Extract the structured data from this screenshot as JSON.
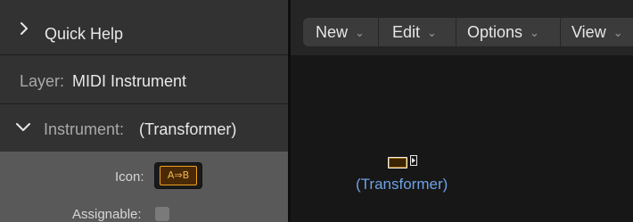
{
  "inspector": {
    "quick_help": "Quick Help",
    "layer_label": "Layer:",
    "layer_value": "MIDI Instrument",
    "instrument_label": "Instrument:",
    "instrument_value": "(Transformer)",
    "icon_label": "Icon:",
    "icon_text": "A⇒B",
    "assignable_label": "Assignable:",
    "assignable_checked": false
  },
  "menubar": {
    "items": [
      {
        "label": "New"
      },
      {
        "label": "Edit"
      },
      {
        "label": "Options"
      },
      {
        "label": "View"
      }
    ]
  },
  "canvas": {
    "node_label": "(Transformer)"
  },
  "colors": {
    "icon_accent": "#f0a020",
    "node_label": "#6ea1e6"
  }
}
